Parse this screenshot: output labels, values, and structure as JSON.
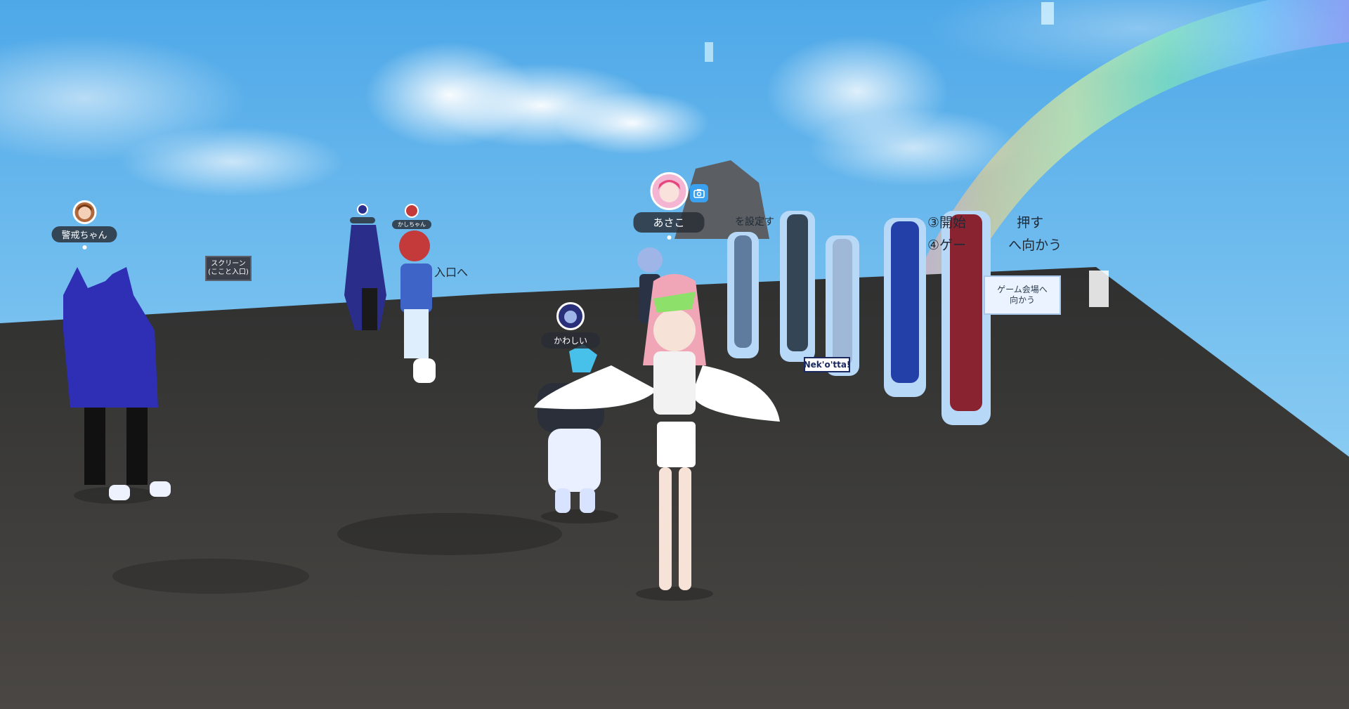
{
  "players": [
    {
      "name": "警戒ちゃん"
    },
    {
      "name": "あさこ"
    },
    {
      "name": "かわしい"
    },
    {
      "name": "かしちゃん"
    }
  ],
  "signs": {
    "screen_line1": "スクリーン",
    "screen_line2": "(ここと入口)",
    "entrance": "入口へ",
    "step3": "③開始",
    "step3_tail": "押す",
    "step4": "④ゲー",
    "step4_tail": "へ向かう",
    "setting": "を設定す",
    "game_venue_line1": "ゲーム会場へ",
    "game_venue_line2": "向かう",
    "nekotta": "Nek'o'tta!"
  },
  "colors": {
    "sky_top": "#5ab0ea",
    "sky_bottom": "#a8dcf7",
    "ground": "#3d3c3a",
    "nametag_bg": "#2c3038",
    "camera_accent": "#3aa0f0"
  },
  "icons": [
    "camera-icon"
  ]
}
